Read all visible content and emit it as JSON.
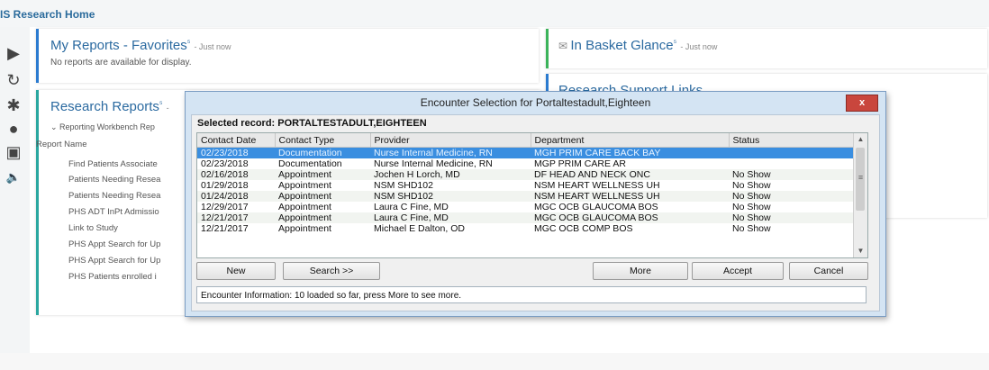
{
  "app": {
    "title": "IS Research Home"
  },
  "favorites": {
    "title": "My Reports - Favorites",
    "stamp": "- Just now",
    "empty_text": "No reports are available for display."
  },
  "inbasket": {
    "title": "In Basket Glance",
    "stamp": "- Just now"
  },
  "research": {
    "title": "Research Reports",
    "stamp": "-",
    "group_label": "Reporting Workbench Rep",
    "items": [
      "Report Name",
      "Find Patients Associate",
      "Patients Needing Resea",
      "Patients Needing Resea",
      "PHS ADT InPt Admissio",
      "Link to Study",
      "PHS Appt Search for Up",
      "PHS Appt Search for Up",
      "PHS Patients enrolled i"
    ]
  },
  "right_partial": {
    "title": "Research Support Links"
  },
  "dialog": {
    "title": "Encounter Selection for Portaltestadult,Eighteen",
    "close_label": "x",
    "selected_label": "Selected record: PORTALTESTADULT,EIGHTEEN",
    "columns": [
      "Contact Date",
      "Contact Type",
      "Provider",
      "Department",
      "Status"
    ],
    "rows": [
      [
        "02/23/2018",
        "Documentation",
        "Nurse Internal Medicine, RN",
        "MGH PRIM CARE BACK BAY",
        ""
      ],
      [
        "02/23/2018",
        "Documentation",
        "Nurse Internal Medicine, RN",
        "MGP PRIM CARE AR",
        ""
      ],
      [
        "02/16/2018",
        "Appointment",
        "Jochen H Lorch, MD",
        "DF HEAD AND NECK ONC",
        "No Show"
      ],
      [
        "01/29/2018",
        "Appointment",
        "NSM SHD102",
        "NSM HEART WELLNESS UH",
        "No Show"
      ],
      [
        "01/24/2018",
        "Appointment",
        "NSM SHD102",
        "NSM HEART WELLNESS UH",
        "No Show"
      ],
      [
        "12/29/2017",
        "Appointment",
        "Laura C Fine, MD",
        "MGC OCB GLAUCOMA BOS",
        "No Show"
      ],
      [
        "12/21/2017",
        "Appointment",
        "Laura C Fine, MD",
        "MGC OCB GLAUCOMA BOS",
        "No Show"
      ],
      [
        "12/21/2017",
        "Appointment",
        "Michael E Dalton, OD",
        "MGC OCB COMP BOS",
        "No Show"
      ]
    ],
    "buttons": {
      "new": "New",
      "search": "Search >>",
      "more": "More",
      "accept": "Accept",
      "cancel": "Cancel"
    },
    "status_text": "Encounter Information: 10 loaded so far, press More to see more."
  },
  "colors": {
    "accent_green": "#3bb35a",
    "accent_teal": "#2aa7a0",
    "accent_blue": "#2b7bd0",
    "selected_row": "#3a8ee0"
  }
}
